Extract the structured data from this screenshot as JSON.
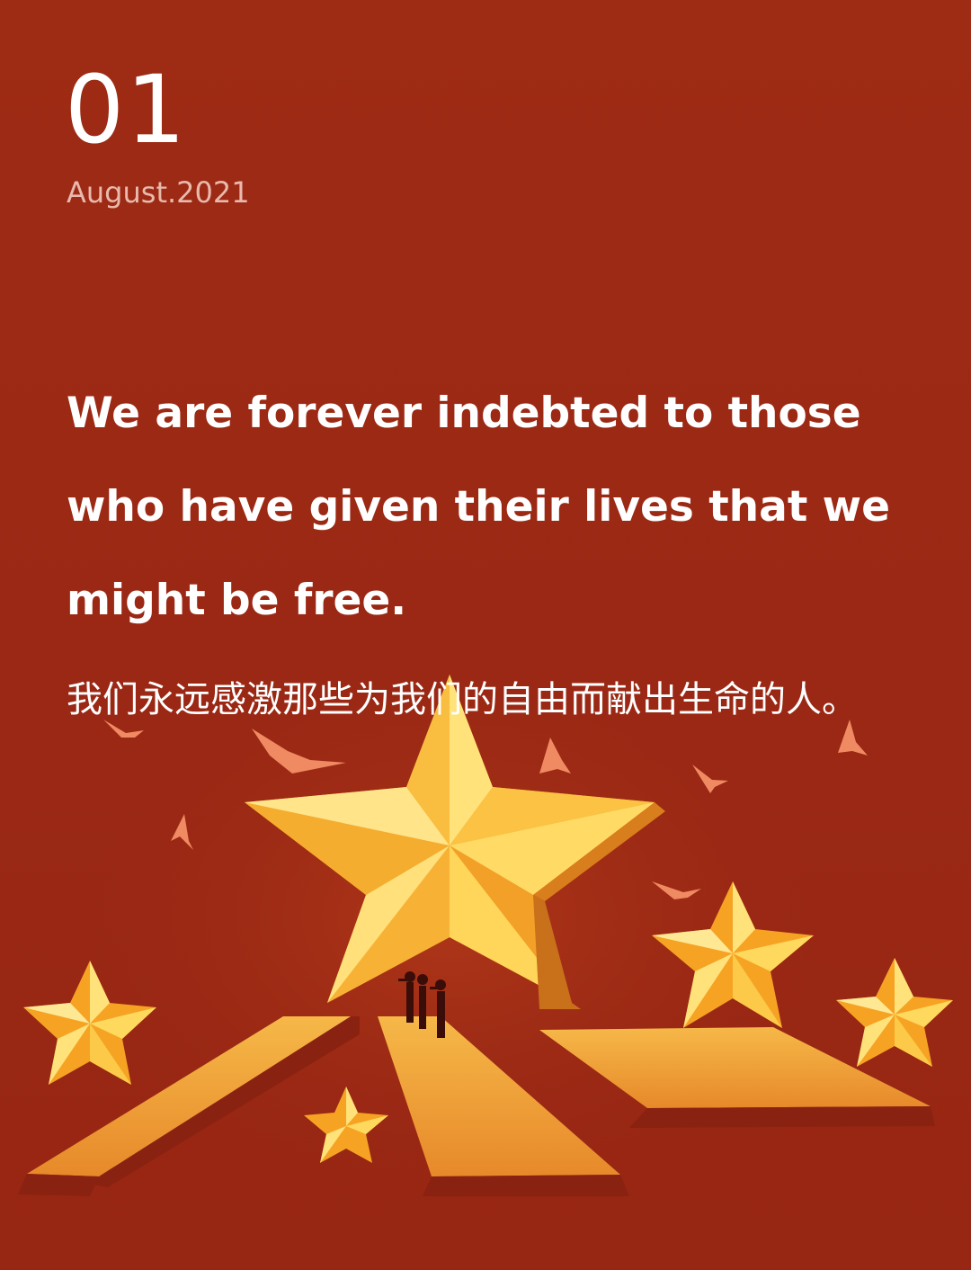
{
  "header": {
    "day": "01",
    "date": "August.2021"
  },
  "quote": {
    "english_lines": [
      "We are forever indebted to those",
      "who have given their lives that we",
      "might be free."
    ],
    "chinese": "我们永远感激那些为我们的自由而献出生命的人。"
  },
  "illustration": {
    "subject": "golden stars, paths, saluting soldiers, birds",
    "colors": {
      "background": "#9b2914",
      "star_light": "#ffd75a",
      "star_dark": "#f0a526",
      "path": "#f3a93a",
      "bird": "#f08a62"
    }
  }
}
